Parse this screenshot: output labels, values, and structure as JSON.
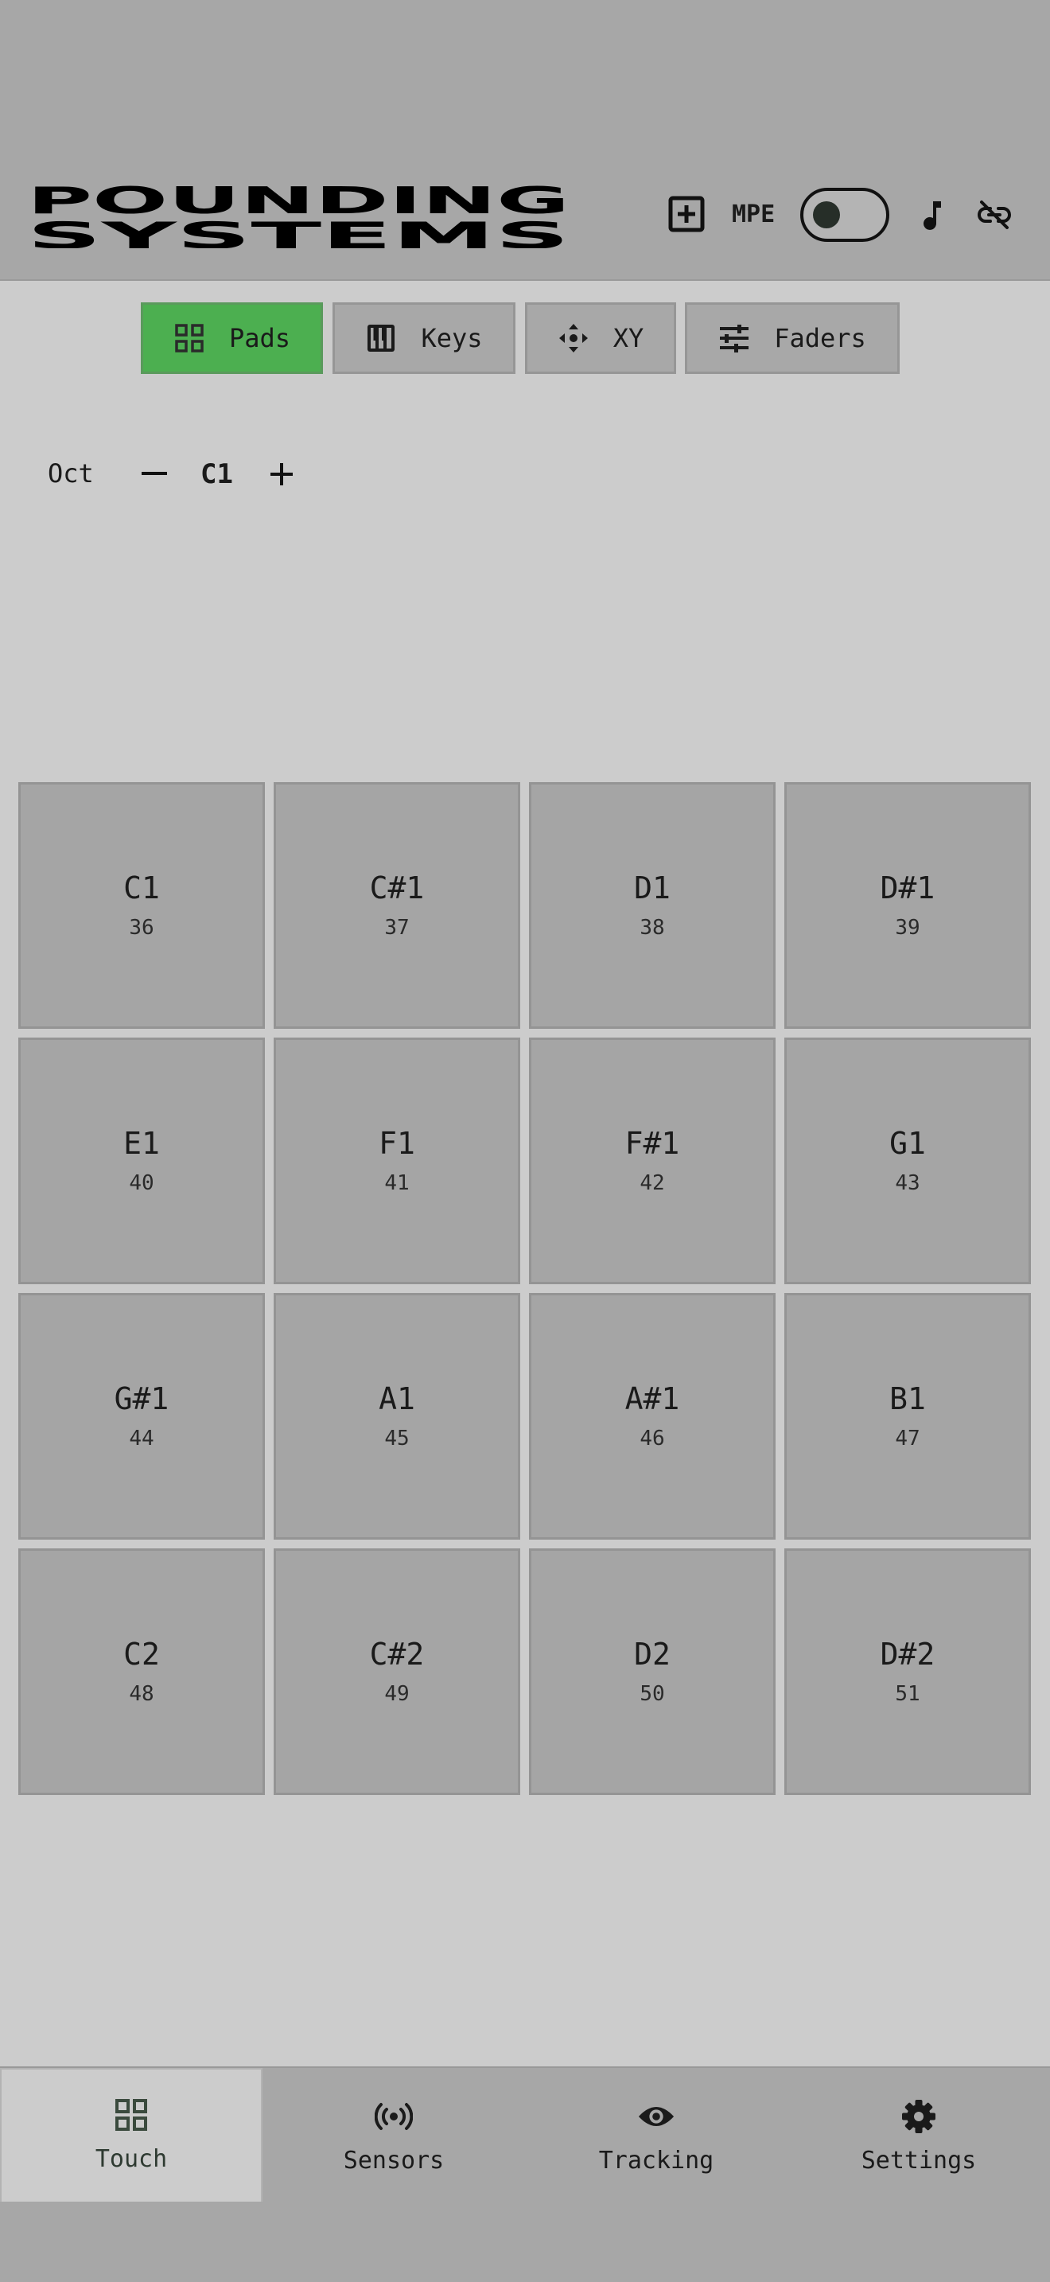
{
  "header": {
    "logo_line1": "POUNDING",
    "logo_line2": "SYSTEMS",
    "mpe_label": "MPE",
    "mpe_enabled": false,
    "icons": [
      "add-box-icon",
      "music-note-icon",
      "link-off-icon"
    ]
  },
  "tabs": [
    {
      "label": "Pads",
      "icon": "grid-icon",
      "active": true
    },
    {
      "label": "Keys",
      "icon": "piano-icon",
      "active": false
    },
    {
      "label": "XY",
      "icon": "move-arrows-icon",
      "active": false
    },
    {
      "label": "Faders",
      "icon": "sliders-icon",
      "active": false
    }
  ],
  "octave": {
    "label": "Oct",
    "value": "C1"
  },
  "pads": [
    {
      "note": "C1",
      "number": "36"
    },
    {
      "note": "C#1",
      "number": "37"
    },
    {
      "note": "D1",
      "number": "38"
    },
    {
      "note": "D#1",
      "number": "39"
    },
    {
      "note": "E1",
      "number": "40"
    },
    {
      "note": "F1",
      "number": "41"
    },
    {
      "note": "F#1",
      "number": "42"
    },
    {
      "note": "G1",
      "number": "43"
    },
    {
      "note": "G#1",
      "number": "44"
    },
    {
      "note": "A1",
      "number": "45"
    },
    {
      "note": "A#1",
      "number": "46"
    },
    {
      "note": "B1",
      "number": "47"
    },
    {
      "note": "C2",
      "number": "48"
    },
    {
      "note": "C#2",
      "number": "49"
    },
    {
      "note": "D2",
      "number": "50"
    },
    {
      "note": "D#2",
      "number": "51"
    }
  ],
  "bottom_nav": [
    {
      "label": "Touch",
      "icon": "grid-icon",
      "active": true
    },
    {
      "label": "Sensors",
      "icon": "sensors-icon",
      "active": false
    },
    {
      "label": "Tracking",
      "icon": "eye-icon",
      "active": false
    },
    {
      "label": "Settings",
      "icon": "gear-icon",
      "active": false
    }
  ],
  "colors": {
    "background": "#cccccc",
    "header": "#a7a7a7",
    "pad": "#a5a5a5",
    "active_tab": "#4caf50"
  }
}
